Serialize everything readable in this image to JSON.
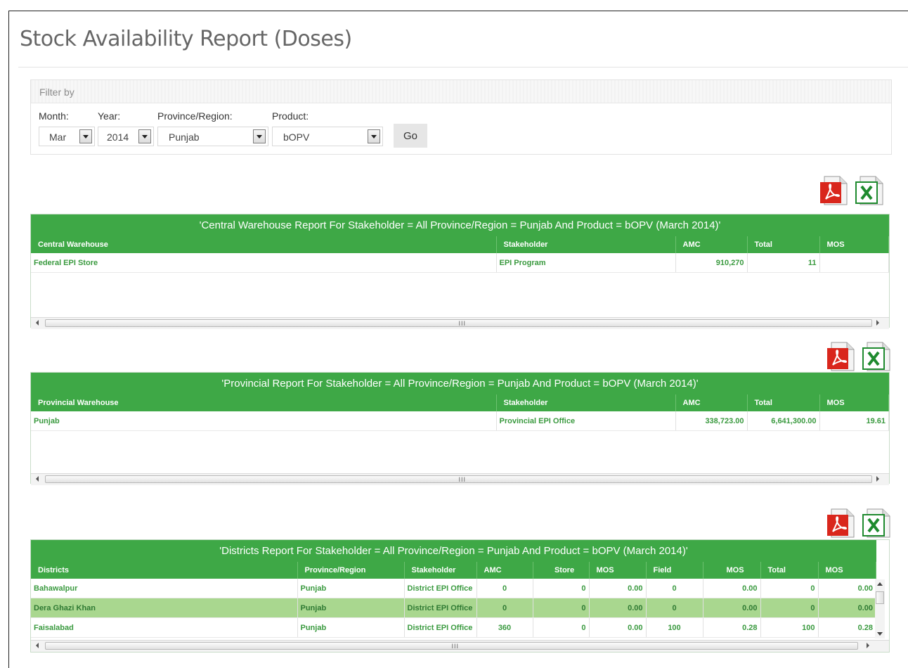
{
  "page": {
    "title": "Stock Availability Report (Doses)"
  },
  "filter": {
    "heading": "Filter by",
    "month_label": "Month:",
    "month_value": "Mar",
    "year_label": "Year:",
    "year_value": "2014",
    "province_label": "Province/Region:",
    "province_value": "Punjab",
    "product_label": "Product:",
    "product_value": "bOPV",
    "go_label": "Go"
  },
  "icons": {
    "pdf": "pdf-icon",
    "excel": "excel-icon",
    "pdf_color": "#d9261c",
    "excel_color": "#1e8a2e"
  },
  "colors": {
    "accent": "#3ea846",
    "highlight_row": "#a9d78f"
  },
  "central": {
    "title": "'Central Warehouse Report For Stakeholder = All Province/Region = Punjab And Product = bOPV (March 2014)'",
    "columns": [
      "Central Warehouse",
      "Stakeholder",
      "AMC",
      "Total",
      "MOS"
    ],
    "rows": [
      [
        "Federal EPI Store",
        "EPI Program",
        "910,270",
        "11",
        ""
      ]
    ]
  },
  "provincial": {
    "title": "'Provincial Report For Stakeholder = All Province/Region = Punjab And Product = bOPV (March 2014)'",
    "columns": [
      "Provincial Warehouse",
      "Stakeholder",
      "AMC",
      "Total",
      "MOS"
    ],
    "rows": [
      [
        "Punjab",
        "Provincial EPI Office",
        "338,723.00",
        "6,641,300.00",
        "19.61"
      ]
    ]
  },
  "districts": {
    "title": "'Districts Report For Stakeholder = All Province/Region = Punjab And Product = bOPV (March 2014)'",
    "columns": [
      "Districts",
      "Province/Region",
      "Stakeholder",
      "AMC",
      "Store",
      "MOS",
      "Field",
      "MOS",
      "Total",
      "MOS"
    ],
    "rows": [
      [
        "Bahawalpur",
        "Punjab",
        "District EPI Office",
        "0",
        "0",
        "0.00",
        "0",
        "0.00",
        "0",
        "0.00"
      ],
      [
        "Dera Ghazi Khan",
        "Punjab",
        "District EPI Office",
        "0",
        "0",
        "0.00",
        "0",
        "0.00",
        "0",
        "0.00"
      ],
      [
        "Faisalabad",
        "Punjab",
        "District EPI Office",
        "360",
        "0",
        "0.00",
        "100",
        "0.28",
        "100",
        "0.28"
      ]
    ]
  },
  "scroll": {
    "grip": "III"
  }
}
